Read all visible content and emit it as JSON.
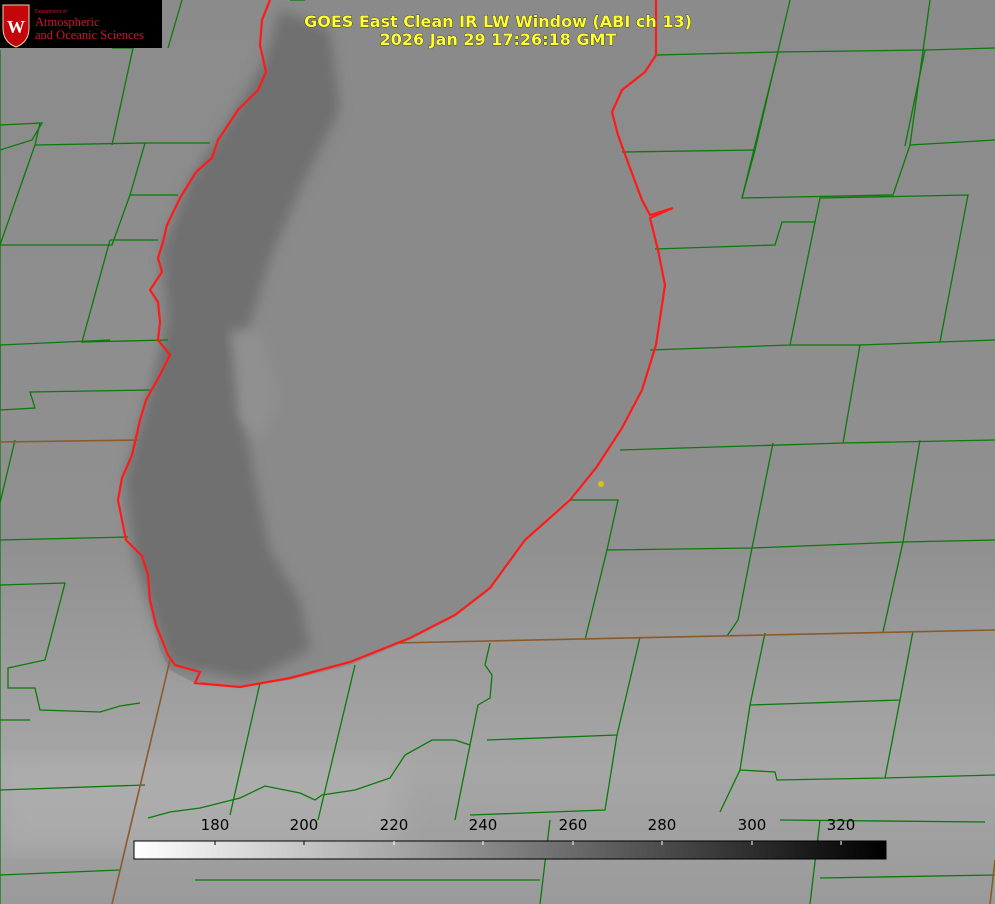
{
  "logo": {
    "department": "Department of",
    "line1": "Atmospheric",
    "line2": "and Oceanic Sciences",
    "crest_letter": "W",
    "brand_color": "#c5050c"
  },
  "header": {
    "title": "GOES East Clean IR LW Window (ABI ch 13)",
    "timestamp": "2026 Jan 29 17:26:18 GMT",
    "text_color": "#ffff33"
  },
  "colorbar": {
    "ticks": [
      "180",
      "200",
      "220",
      "240",
      "260",
      "280",
      "300",
      "320"
    ],
    "gradient": "white-to-black"
  },
  "map": {
    "county_line_color": "#0a7a0a",
    "shoreline_color": "#ff1a1a",
    "state_line_color": "#8b5a2b",
    "marker_color": "#d4c218"
  }
}
